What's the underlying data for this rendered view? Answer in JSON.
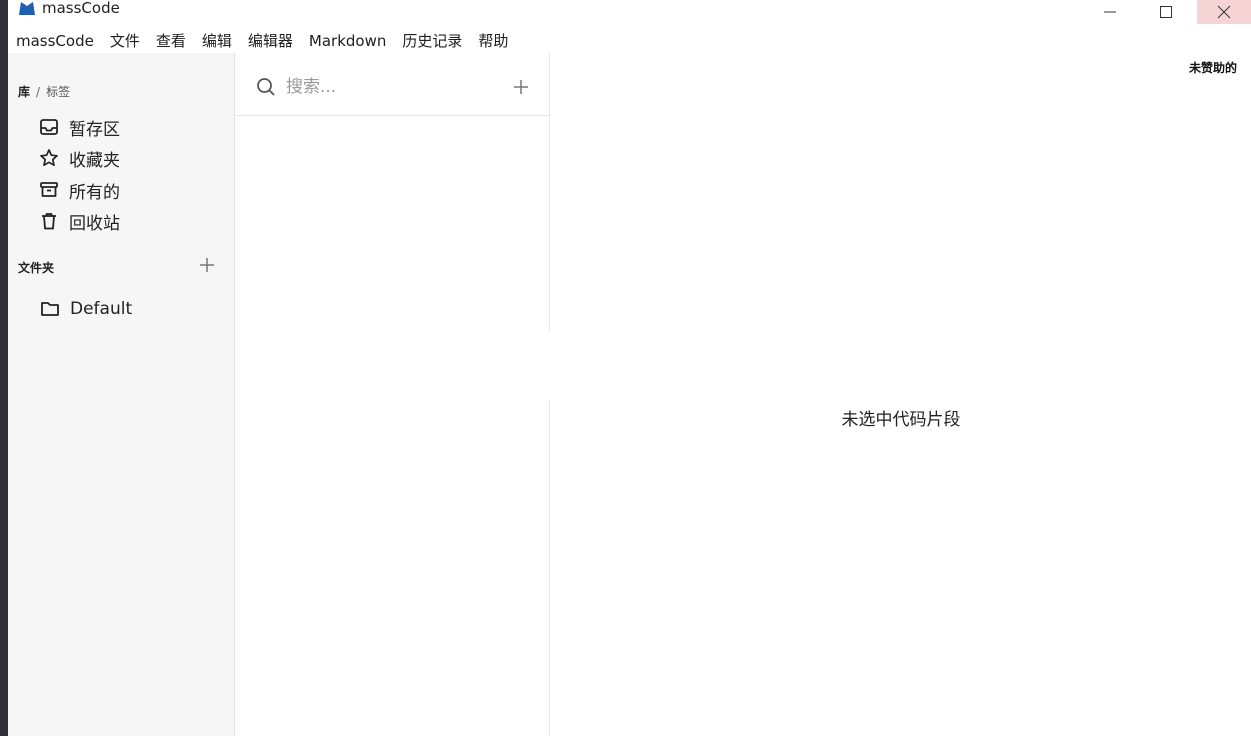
{
  "window": {
    "title": "massCode",
    "brand_color": "#1e5fb4",
    "close_hover_color": "#f6d4d6"
  },
  "menu": [
    {
      "label": "massCode"
    },
    {
      "label": "文件"
    },
    {
      "label": "查看"
    },
    {
      "label": "编辑"
    },
    {
      "label": "编辑器"
    },
    {
      "label": "Markdown"
    },
    {
      "label": "历史记录"
    },
    {
      "label": "帮助"
    }
  ],
  "sidebar": {
    "library_label": "库",
    "separator": "/",
    "tags_label": "标签",
    "items": [
      {
        "label": "暂存区",
        "icon": "inbox-icon"
      },
      {
        "label": "收藏夹",
        "icon": "star-icon"
      },
      {
        "label": "所有的",
        "icon": "archive-icon"
      },
      {
        "label": "回收站",
        "icon": "trash-icon"
      }
    ],
    "folders_label": "文件夹",
    "folders": [
      {
        "label": "Default",
        "icon": "folder-icon"
      }
    ]
  },
  "search": {
    "placeholder": "搜索...",
    "value": ""
  },
  "main": {
    "sponsor_label": "未赞助的",
    "empty_message": "未选中代码片段"
  }
}
